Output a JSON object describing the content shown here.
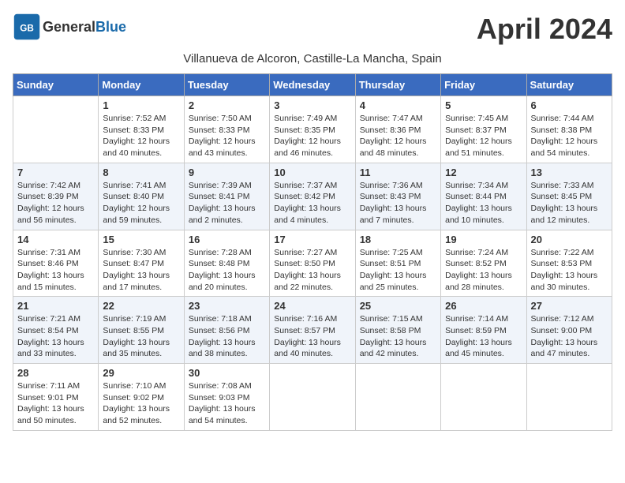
{
  "header": {
    "logo_general": "General",
    "logo_blue": "Blue",
    "month_title": "April 2024",
    "location": "Villanueva de Alcoron, Castille-La Mancha, Spain"
  },
  "weekdays": [
    "Sunday",
    "Monday",
    "Tuesday",
    "Wednesday",
    "Thursday",
    "Friday",
    "Saturday"
  ],
  "weeks": [
    [
      {
        "day": "",
        "info": ""
      },
      {
        "day": "1",
        "info": "Sunrise: 7:52 AM\nSunset: 8:33 PM\nDaylight: 12 hours\nand 40 minutes."
      },
      {
        "day": "2",
        "info": "Sunrise: 7:50 AM\nSunset: 8:33 PM\nDaylight: 12 hours\nand 43 minutes."
      },
      {
        "day": "3",
        "info": "Sunrise: 7:49 AM\nSunset: 8:35 PM\nDaylight: 12 hours\nand 46 minutes."
      },
      {
        "day": "4",
        "info": "Sunrise: 7:47 AM\nSunset: 8:36 PM\nDaylight: 12 hours\nand 48 minutes."
      },
      {
        "day": "5",
        "info": "Sunrise: 7:45 AM\nSunset: 8:37 PM\nDaylight: 12 hours\nand 51 minutes."
      },
      {
        "day": "6",
        "info": "Sunrise: 7:44 AM\nSunset: 8:38 PM\nDaylight: 12 hours\nand 54 minutes."
      }
    ],
    [
      {
        "day": "7",
        "info": "Sunrise: 7:42 AM\nSunset: 8:39 PM\nDaylight: 12 hours\nand 56 minutes."
      },
      {
        "day": "8",
        "info": "Sunrise: 7:41 AM\nSunset: 8:40 PM\nDaylight: 12 hours\nand 59 minutes."
      },
      {
        "day": "9",
        "info": "Sunrise: 7:39 AM\nSunset: 8:41 PM\nDaylight: 13 hours\nand 2 minutes."
      },
      {
        "day": "10",
        "info": "Sunrise: 7:37 AM\nSunset: 8:42 PM\nDaylight: 13 hours\nand 4 minutes."
      },
      {
        "day": "11",
        "info": "Sunrise: 7:36 AM\nSunset: 8:43 PM\nDaylight: 13 hours\nand 7 minutes."
      },
      {
        "day": "12",
        "info": "Sunrise: 7:34 AM\nSunset: 8:44 PM\nDaylight: 13 hours\nand 10 minutes."
      },
      {
        "day": "13",
        "info": "Sunrise: 7:33 AM\nSunset: 8:45 PM\nDaylight: 13 hours\nand 12 minutes."
      }
    ],
    [
      {
        "day": "14",
        "info": "Sunrise: 7:31 AM\nSunset: 8:46 PM\nDaylight: 13 hours\nand 15 minutes."
      },
      {
        "day": "15",
        "info": "Sunrise: 7:30 AM\nSunset: 8:47 PM\nDaylight: 13 hours\nand 17 minutes."
      },
      {
        "day": "16",
        "info": "Sunrise: 7:28 AM\nSunset: 8:48 PM\nDaylight: 13 hours\nand 20 minutes."
      },
      {
        "day": "17",
        "info": "Sunrise: 7:27 AM\nSunset: 8:50 PM\nDaylight: 13 hours\nand 22 minutes."
      },
      {
        "day": "18",
        "info": "Sunrise: 7:25 AM\nSunset: 8:51 PM\nDaylight: 13 hours\nand 25 minutes."
      },
      {
        "day": "19",
        "info": "Sunrise: 7:24 AM\nSunset: 8:52 PM\nDaylight: 13 hours\nand 28 minutes."
      },
      {
        "day": "20",
        "info": "Sunrise: 7:22 AM\nSunset: 8:53 PM\nDaylight: 13 hours\nand 30 minutes."
      }
    ],
    [
      {
        "day": "21",
        "info": "Sunrise: 7:21 AM\nSunset: 8:54 PM\nDaylight: 13 hours\nand 33 minutes."
      },
      {
        "day": "22",
        "info": "Sunrise: 7:19 AM\nSunset: 8:55 PM\nDaylight: 13 hours\nand 35 minutes."
      },
      {
        "day": "23",
        "info": "Sunrise: 7:18 AM\nSunset: 8:56 PM\nDaylight: 13 hours\nand 38 minutes."
      },
      {
        "day": "24",
        "info": "Sunrise: 7:16 AM\nSunset: 8:57 PM\nDaylight: 13 hours\nand 40 minutes."
      },
      {
        "day": "25",
        "info": "Sunrise: 7:15 AM\nSunset: 8:58 PM\nDaylight: 13 hours\nand 42 minutes."
      },
      {
        "day": "26",
        "info": "Sunrise: 7:14 AM\nSunset: 8:59 PM\nDaylight: 13 hours\nand 45 minutes."
      },
      {
        "day": "27",
        "info": "Sunrise: 7:12 AM\nSunset: 9:00 PM\nDaylight: 13 hours\nand 47 minutes."
      }
    ],
    [
      {
        "day": "28",
        "info": "Sunrise: 7:11 AM\nSunset: 9:01 PM\nDaylight: 13 hours\nand 50 minutes."
      },
      {
        "day": "29",
        "info": "Sunrise: 7:10 AM\nSunset: 9:02 PM\nDaylight: 13 hours\nand 52 minutes."
      },
      {
        "day": "30",
        "info": "Sunrise: 7:08 AM\nSunset: 9:03 PM\nDaylight: 13 hours\nand 54 minutes."
      },
      {
        "day": "",
        "info": ""
      },
      {
        "day": "",
        "info": ""
      },
      {
        "day": "",
        "info": ""
      },
      {
        "day": "",
        "info": ""
      }
    ]
  ]
}
